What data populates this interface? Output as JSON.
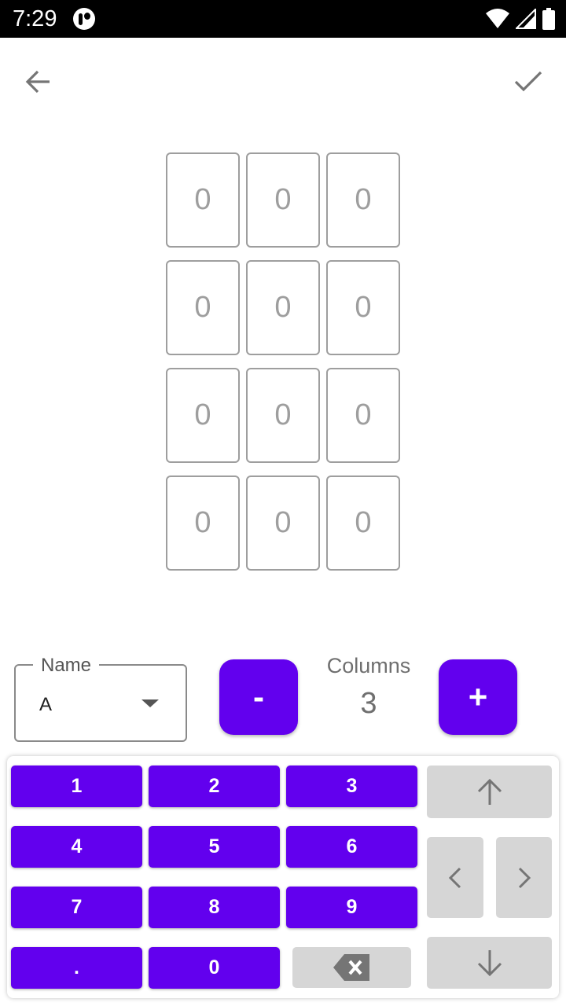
{
  "status_bar": {
    "time": "7:29"
  },
  "grid": {
    "cells": [
      "0",
      "0",
      "0",
      "0",
      "0",
      "0",
      "0",
      "0",
      "0",
      "0",
      "0",
      "0"
    ]
  },
  "controls": {
    "name_label": "Name",
    "name_value": "A",
    "minus_label": "-",
    "plus_label": "+",
    "columns_label": "Columns",
    "columns_value": "3"
  },
  "keypad": {
    "keys": [
      "1",
      "2",
      "3",
      "4",
      "5",
      "6",
      "7",
      "8",
      "9",
      ".",
      "0"
    ]
  },
  "icons": {
    "back": "arrow-back-icon",
    "confirm": "check-icon",
    "backspace": "backspace-icon",
    "up": "arrow-up-icon",
    "left": "chevron-left-icon",
    "right": "chevron-right-icon",
    "down": "arrow-down-icon"
  },
  "colors": {
    "accent": "#6200ee",
    "key_grey": "#d6d6d6",
    "cell_border": "#9e9e9e"
  }
}
